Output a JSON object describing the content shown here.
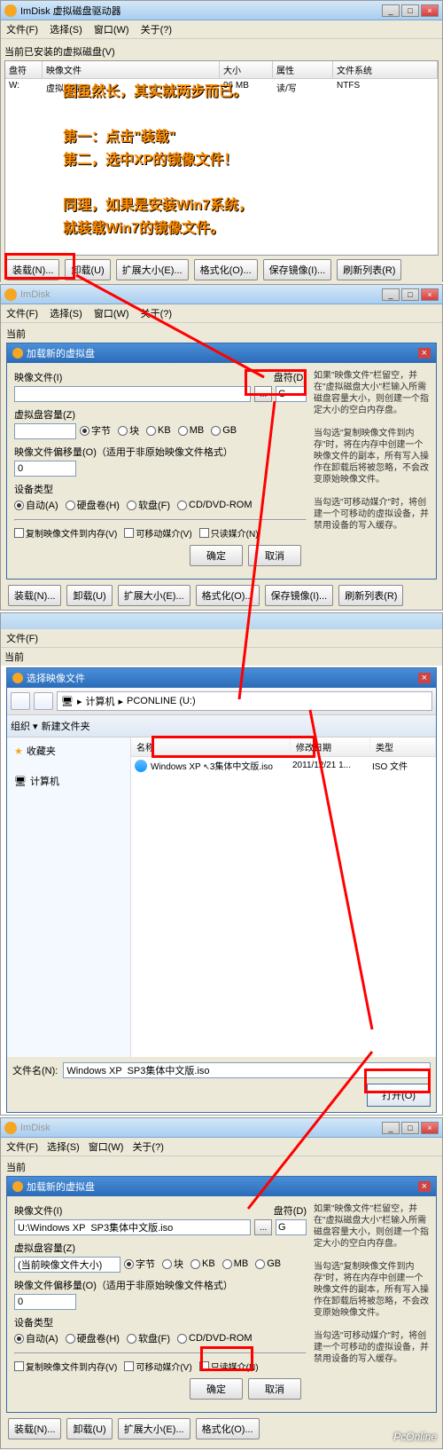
{
  "s1": {
    "title": "ImDisk 虚拟磁盘驱动器",
    "menu": {
      "file": "文件(F)",
      "select": "选择(S)",
      "window": "窗口(W)",
      "about": "关于(?)"
    },
    "installed": "当前已安装的虚拟磁盘(V)",
    "cols": {
      "drive": "盘符",
      "image": "映像文件",
      "size": "大小",
      "attr": "属性",
      "fs": "文件系统"
    },
    "row": {
      "drive": "W:",
      "image": "虚拟内存",
      "size": "96 MB",
      "attr": "读/写",
      "fs": "NTFS"
    },
    "overlay": {
      "l1": "图虽然长，其实就两步而已。",
      "l2": "第一：点击\"装载\"",
      "l3": "第二，选中XP的镜像文件！",
      "l4": "同理，如果是安装Win7系统，",
      "l5": "就装载Win7的镜像文件。"
    },
    "btns": {
      "mount": "装载(N)...",
      "unmount": "卸载(U)",
      "extend": "扩展大小(E)...",
      "format": "格式化(O)...",
      "save": "保存镜像(I)...",
      "refresh": "刷新列表(R)"
    }
  },
  "s2": {
    "dlgtitle": "加载新的虚拟盘",
    "imagefile": "映像文件(I)",
    "drive": "盘符(D)",
    "capacity": "虚拟盘容量(Z)",
    "units": {
      "byte": "字节",
      "block": "块",
      "kb": "KB",
      "mb": "MB",
      "gb": "GB"
    },
    "offset": "映像文件偏移量(O)（适用于非原始映像文件格式）",
    "offsetval": "0",
    "devtype": "设备类型",
    "types": {
      "auto": "自动(A)",
      "hdd": "硬盘卷(H)",
      "floppy": "软盘(F)",
      "cd": "CD/DVD-ROM"
    },
    "copymem": "复制映像文件到内存(V)",
    "removable": "可移动媒介(V)",
    "readonly": "只读媒介(N)",
    "ok": "确定",
    "cancel": "取消",
    "help1": "如果\"映像文件\"栏留空，并在\"虚拟磁盘大小\"栏输入所需磁盘容量大小，则创建一个指定大小的空白内存盘。",
    "help2": "当勾选\"复制映像文件到内存\"时，将在内存中创建一个映像文件的副本，所有写入操作在卸载后将被忽略，不会改变原始映像文件。",
    "help3": "当勾选\"可移动媒介\"时，将创建一个可移动的虚拟设备，并禁用设备的写入缓存。"
  },
  "s3": {
    "dlgtitle": "选择映像文件",
    "menu": {
      "file": "文件(F)"
    },
    "org": "组织 ▾",
    "newfolder": "新建文件夹",
    "breadcrumb": {
      "computer": "计算机",
      "drive": "PCONLINE (U:)"
    },
    "sidebar": {
      "fav": "收藏夹",
      "computer": "计算机"
    },
    "cols": {
      "name": "名称",
      "date": "修改日期",
      "type": "类型"
    },
    "file": {
      "name": "Windows XP",
      "rest": "3集体中文版.iso",
      "date": "2011/12/21 1...",
      "type": "ISO 文件"
    },
    "filelabel": "文件名(N):",
    "filename": "Windows XP  SP3集体中文版.iso",
    "open": "打开(O)"
  },
  "s4": {
    "imageval": "U:\\Windows XP  SP3集体中文版.iso",
    "driveval": "G",
    "capval": "(当前映像文件大小)"
  },
  "watermark": "PcOnline"
}
